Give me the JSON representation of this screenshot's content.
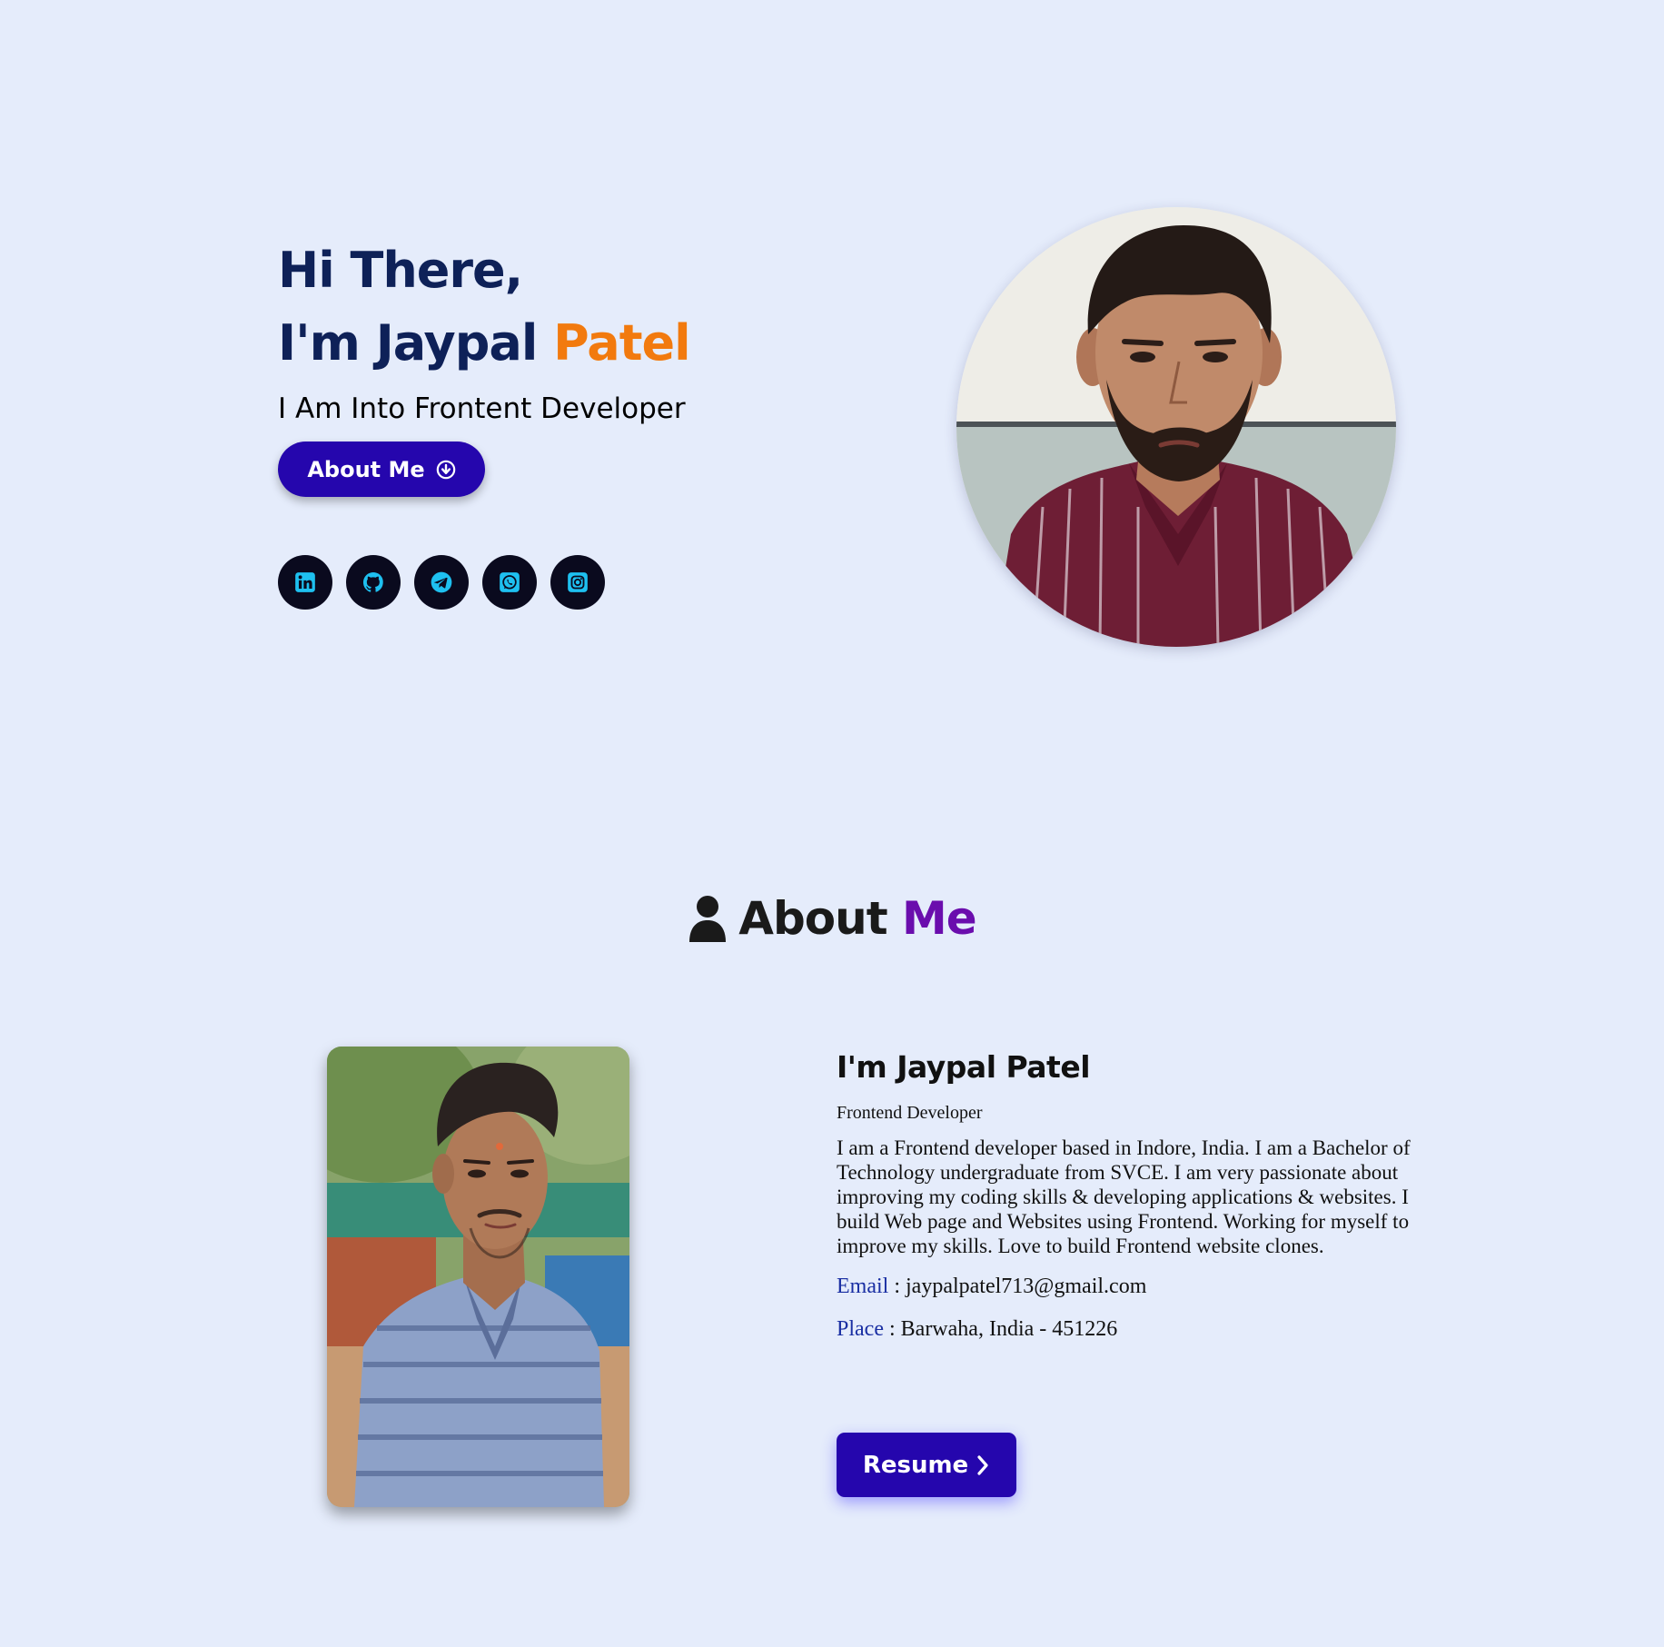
{
  "hero": {
    "greeting": "Hi There,",
    "name_prefix": "I'm Jaypal ",
    "name_highlight": "Patel",
    "subtitle": "I Am Into Frontent Developer",
    "about_button_label": "About Me",
    "about_button_icon": "arrow-down-circle-icon",
    "socials": [
      {
        "name": "linkedin",
        "icon": "linkedin-icon"
      },
      {
        "name": "github",
        "icon": "github-icon"
      },
      {
        "name": "telegram",
        "icon": "telegram-icon"
      },
      {
        "name": "whatsapp",
        "icon": "whatsapp-icon"
      },
      {
        "name": "instagram",
        "icon": "instagram-icon"
      }
    ],
    "photo": "profile-photo-circle"
  },
  "about": {
    "heading_prefix": "About ",
    "heading_accent": "Me",
    "heading_icon": "user-icon",
    "photo": "portrait-photo",
    "name": "I'm Jaypal Patel",
    "role": "Frontend Developer",
    "bio": "I am a Frontend developer based in Indore, India. I am a Bachelor of Technology undergraduate from SVCE. I am very passionate about improving my coding skills & developing applications & websites. I build Web page and Websites using Frontend. Working for myself to improve my skills. Love to build Frontend website clones.",
    "email_label": "Email",
    "email_value": "jaypalpatel713@gmail.com",
    "place_label": "Place",
    "place_value": "Barwaha, India - 451226",
    "resume_label": "Resume",
    "resume_icon": "chevron-right-icon"
  },
  "colors": {
    "background": "#e5ecfb",
    "navy": "#0e2158",
    "orange": "#f27a0e",
    "button": "#2506ad",
    "purple": "#6a0dad",
    "social_icon": "#1ec0f0"
  }
}
